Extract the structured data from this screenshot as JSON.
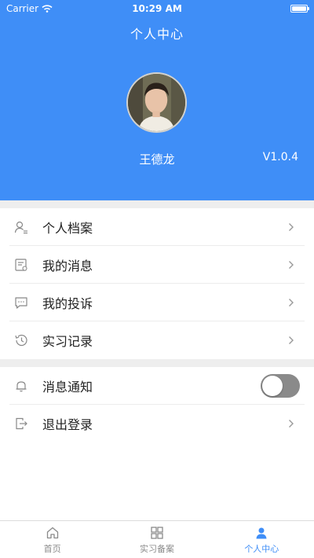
{
  "status_bar": {
    "carrier": "Carrier",
    "time": "10:29 AM"
  },
  "header": {
    "title": "个人中心",
    "user_name": "王德龙",
    "version": "V1.0.4"
  },
  "menu_group1": [
    {
      "label": "个人档案",
      "icon": "person-card-icon"
    },
    {
      "label": "我的消息",
      "icon": "message-doc-icon"
    },
    {
      "label": "我的投诉",
      "icon": "chat-bubble-icon"
    },
    {
      "label": "实习记录",
      "icon": "history-clock-icon"
    }
  ],
  "menu_group2": {
    "notify_label": "消息通知",
    "notify_enabled": false,
    "logout_label": "退出登录"
  },
  "tabbar": [
    {
      "label": "首页",
      "icon": "home-icon",
      "active": false
    },
    {
      "label": "实习备案",
      "icon": "grid-icon",
      "active": false
    },
    {
      "label": "个人中心",
      "icon": "person-icon",
      "active": true
    }
  ],
  "colors": {
    "primary": "#3f8ef7",
    "toggle_off": "#8a8a8a"
  }
}
